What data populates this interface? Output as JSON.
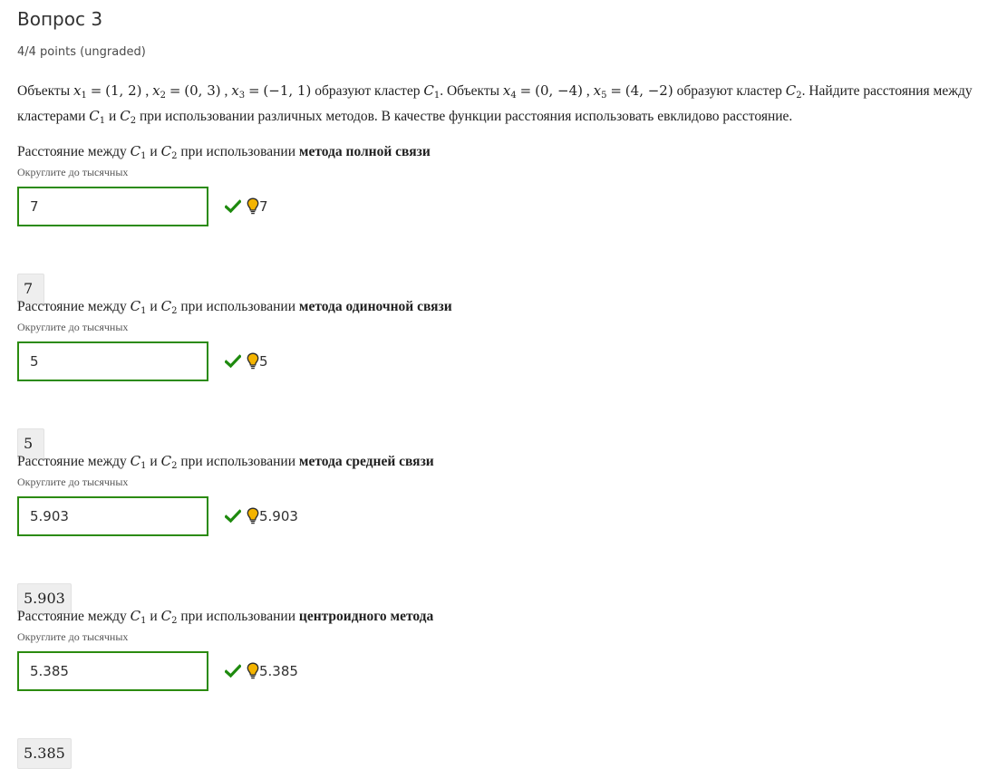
{
  "header": {
    "title": "Вопрос 3",
    "points": "4/4 points (ungraded)"
  },
  "problem": {
    "t1": "Объекты",
    "t2": "образуют кластер",
    "t3": ". Объекты",
    "t4": "образуют кластер",
    "t5": ". Найдите расстояния между",
    "t6": "кластерами",
    "t7": "и",
    "t8": "при использовании различных методов. В качестве функции расстояния использовать евклидово расстояние.",
    "x1": "(1, 2)",
    "x2": "(0, 3)",
    "x3": "(−1, 1)",
    "x4": "(0, −4)",
    "x5": "(4, −2)"
  },
  "common": {
    "q_prefix": "Расстояние между",
    "q_and": "и",
    "q_using": "при использовании",
    "hint": "Округлите до тысячных"
  },
  "parts": [
    {
      "method": "метода полной связи",
      "value": "7",
      "preview": "7",
      "status_value": "7"
    },
    {
      "method": "метода одиночной связи",
      "value": "5",
      "preview": "5",
      "status_value": "5"
    },
    {
      "method": "метода средней связи",
      "value": "5.903",
      "preview": "5.903",
      "status_value": "5.903"
    },
    {
      "method": "центроидного метода",
      "value": "5.385",
      "preview": "5.385",
      "status_value": "5.385"
    }
  ],
  "colors": {
    "correct_border": "#2b8b0f",
    "check": "#1e8a0e",
    "bulb": "#f4b400"
  },
  "icons": {
    "status": "checkmark-icon",
    "hint": "lightbulb-icon"
  }
}
